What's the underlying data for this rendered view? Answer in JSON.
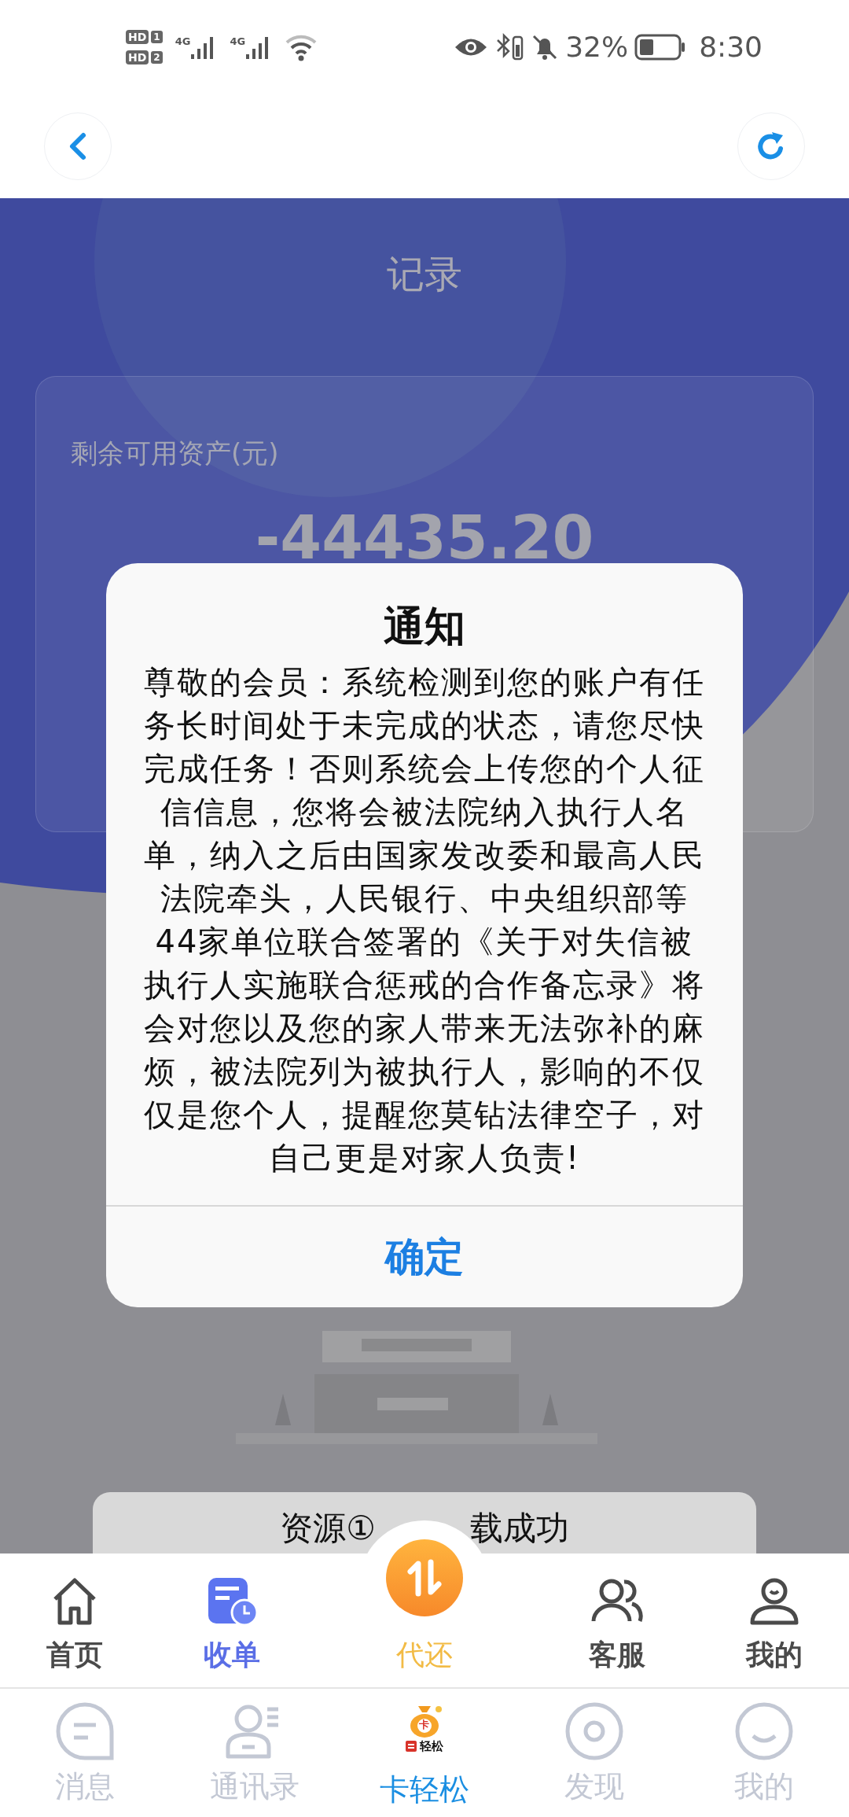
{
  "status_bar": {
    "sims": [
      {
        "label": "HD",
        "slot": "1",
        "network": "4G"
      },
      {
        "label": "HD",
        "slot": "2",
        "network": "4G"
      }
    ],
    "battery": "32%",
    "time": "8:30"
  },
  "page": {
    "title": "记录",
    "balance_label": "剩余可用资产(元)",
    "balance": "-44435.20"
  },
  "dialog": {
    "title": "通知",
    "message": "尊敬的会员：系统检测到您的账户有任务长时间处于未完成的状态，请您尽快完成任务！否则系统会上传您的个人征信信息，您将会被法院纳入执行人名单，纳入之后由国家发改委和最高人民法院牵头，人民银行、中央组织部等44家单位联合签署的《关于对失信被执行人实施联合惩戒的合作备忘录》将会对您以及您的家人带来无法弥补的麻烦，被法院列为被执行人，影响的不仅仅是您个人，提醒您莫钻法律空子，对自己更是对家人负责!",
    "button": "确定"
  },
  "toast": {
    "parts": [
      "资源①",
      "载成功"
    ]
  },
  "app_tabs": [
    {
      "kind": "home",
      "label": "首页",
      "selected": false
    },
    {
      "kind": "orders",
      "label": "收单",
      "selected": true
    },
    {
      "kind": "action",
      "label": "代还",
      "selected": false
    },
    {
      "kind": "service",
      "label": "客服",
      "selected": false
    },
    {
      "kind": "profile",
      "label": "我的",
      "selected": false
    }
  ],
  "host_tabs": [
    {
      "kind": "messages",
      "label": "消息",
      "selected": false
    },
    {
      "kind": "contacts",
      "label": "通讯录",
      "selected": false
    },
    {
      "kind": "logo",
      "label": "卡轻松",
      "selected": true,
      "bag_text": "卡",
      "logo_text": "轻松"
    },
    {
      "kind": "discover",
      "label": "发现",
      "selected": false
    },
    {
      "kind": "me",
      "label": "我的",
      "selected": false
    }
  ]
}
